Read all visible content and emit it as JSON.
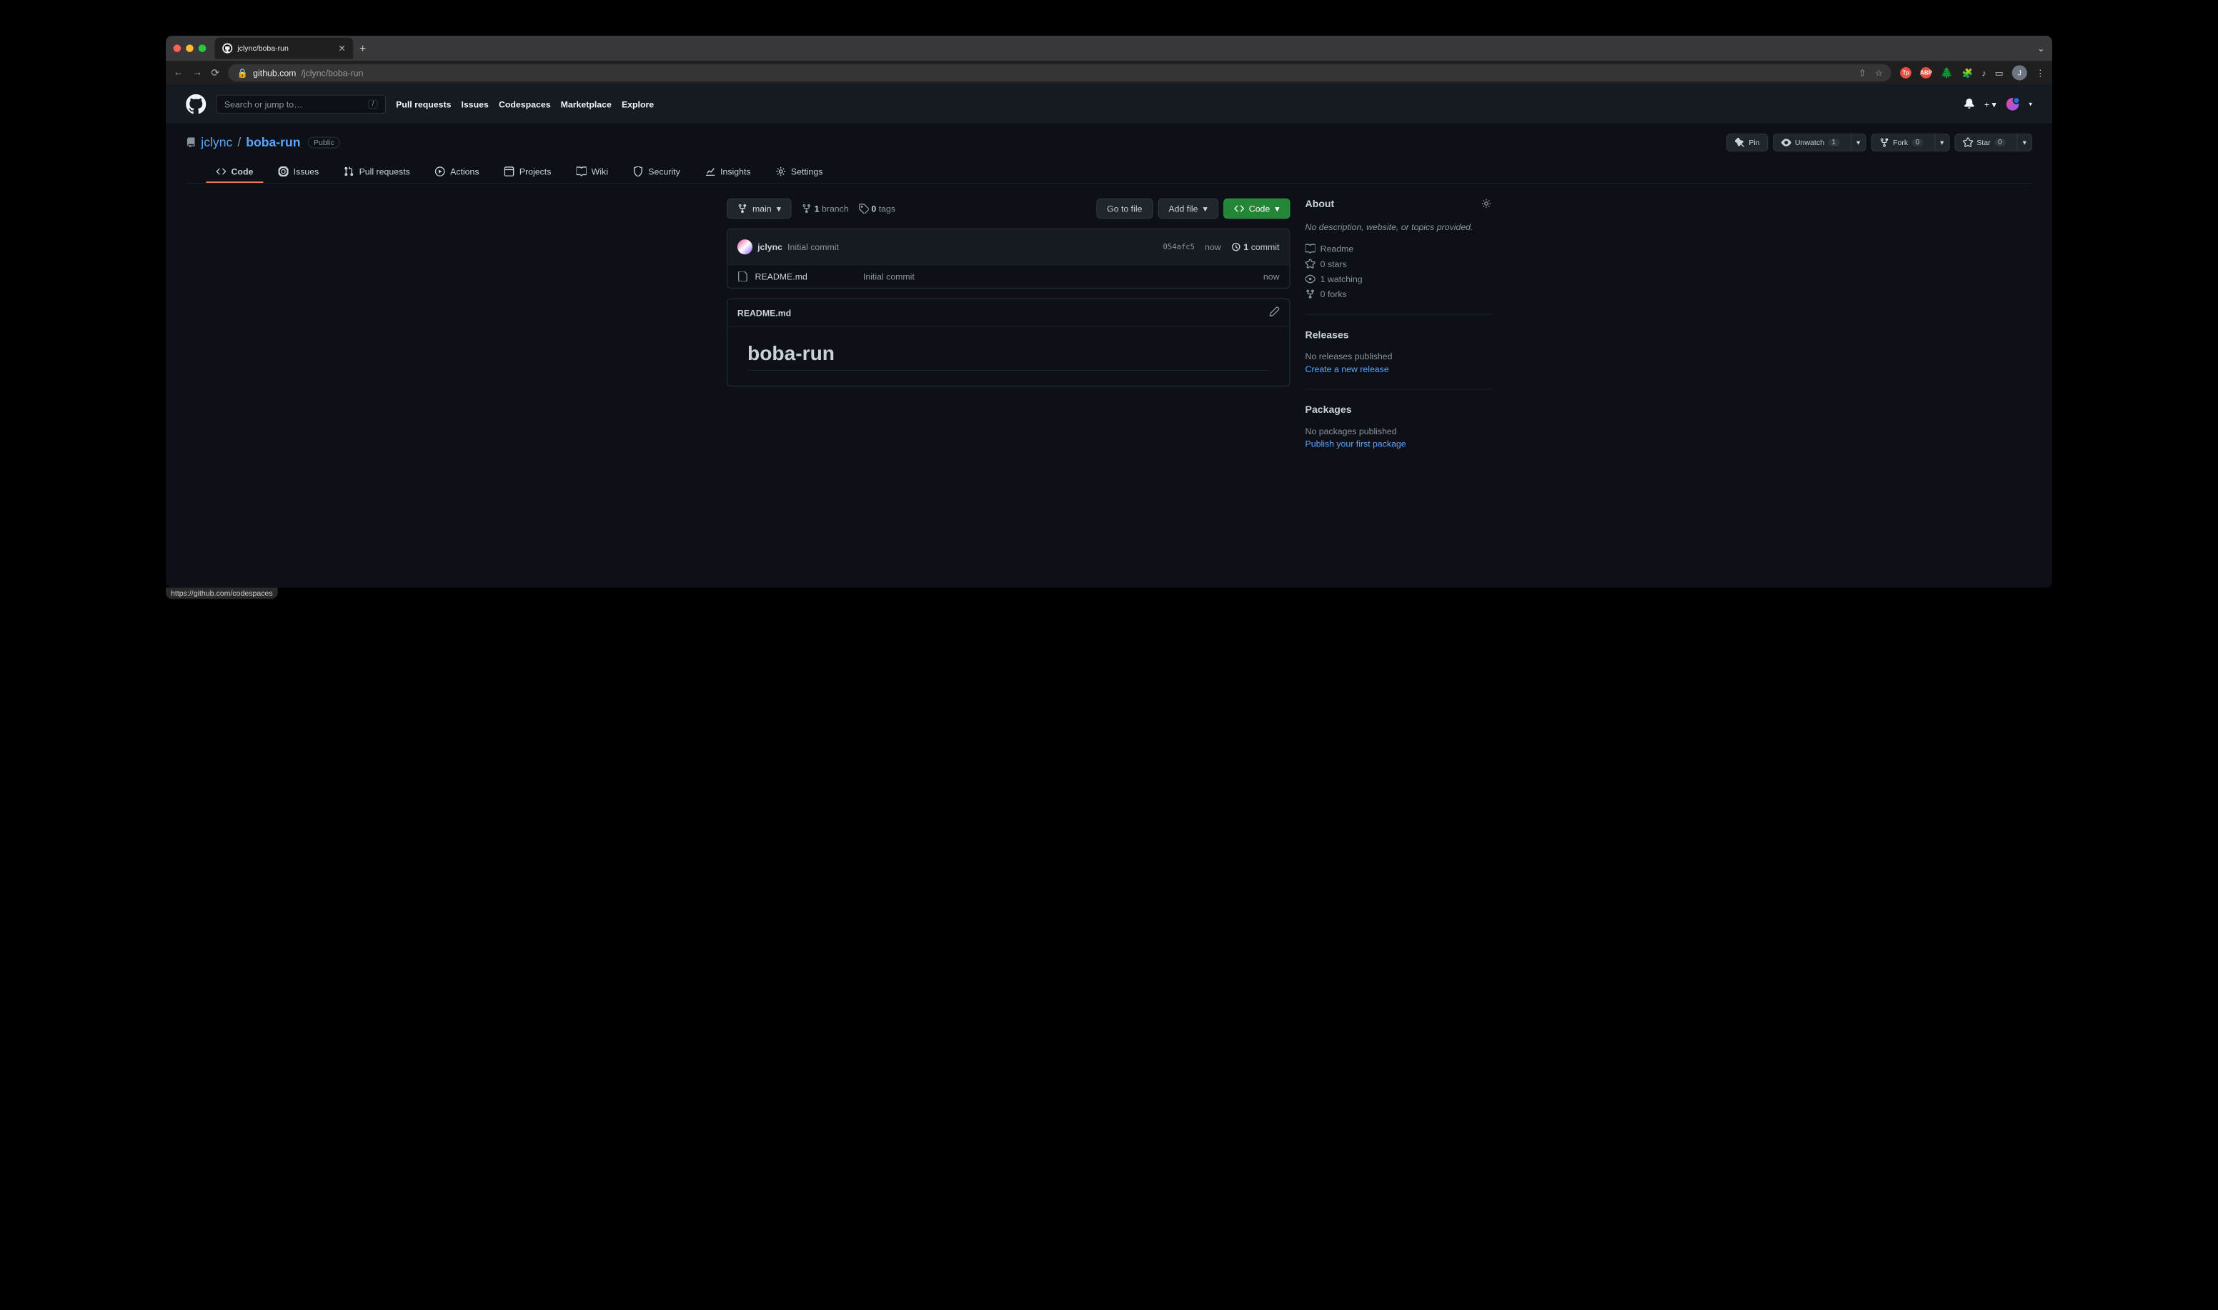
{
  "browser": {
    "tab_title": "jclync/boba-run",
    "url_domain": "github.com",
    "url_path": "/jclync/boba-run",
    "status_url": "https://github.com/codespaces"
  },
  "header": {
    "search_placeholder": "Search or jump to…",
    "nav": [
      "Pull requests",
      "Issues",
      "Codespaces",
      "Marketplace",
      "Explore"
    ]
  },
  "repo": {
    "owner": "jclync",
    "name": "boba-run",
    "visibility": "Public",
    "actions": {
      "pin": "Pin",
      "unwatch": "Unwatch",
      "watch_count": "1",
      "fork": "Fork",
      "fork_count": "0",
      "star": "Star",
      "star_count": "0"
    }
  },
  "tabs": [
    "Code",
    "Issues",
    "Pull requests",
    "Actions",
    "Projects",
    "Wiki",
    "Security",
    "Insights",
    "Settings"
  ],
  "file_nav": {
    "branch": "main",
    "branch_count": "1",
    "branch_label": "branch",
    "tag_count": "0",
    "tag_label": "tags",
    "go_to_file": "Go to file",
    "add_file": "Add file",
    "code": "Code"
  },
  "commit": {
    "author": "jclync",
    "message": "Initial commit",
    "sha": "054afc5",
    "time": "now",
    "count": "1",
    "count_label": "commit"
  },
  "files": [
    {
      "name": "README.md",
      "message": "Initial commit",
      "time": "now"
    }
  ],
  "readme": {
    "filename": "README.md",
    "heading": "boba-run"
  },
  "about": {
    "title": "About",
    "description": "No description, website, or topics provided.",
    "readme": "Readme",
    "stars": "0 stars",
    "watching": "1 watching",
    "forks": "0 forks"
  },
  "releases": {
    "title": "Releases",
    "empty": "No releases published",
    "link": "Create a new release"
  },
  "packages": {
    "title": "Packages",
    "empty": "No packages published",
    "link": "Publish your first package"
  }
}
